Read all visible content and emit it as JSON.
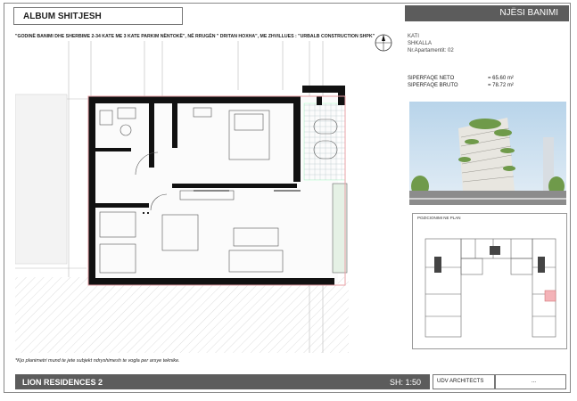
{
  "header": {
    "album": "ALBUM SHITJESH",
    "section": "NJËSI BANIMI"
  },
  "project_description": "\"GODINË BANIMI DHE SHERBIME 2-34 KATE ME 3 KATE PARKIM NËNTOKË\", NË RRUGËN \" DRITAN HOXHA\", ME ZHVILLUES : \"URBALB CONSTRUCTION SHPK\"",
  "unit": {
    "floor": "KATI",
    "stair": "SHKALLA",
    "apartment_no": "Nr.Apartamentit: 02"
  },
  "areas": [
    {
      "label": "SIPERFAQE NETO",
      "value": "= 65.60 m²"
    },
    {
      "label": "SIPERFAQE BRUTO",
      "value": "= 78.72 m²"
    }
  ],
  "position_plan_title": "POZICIONIMI NE PLAN",
  "note": "*Kjo planimetri mund te jete subjekt ndryshimesh te vogla per arsye teknike.",
  "footer": {
    "project": "LION  RESIDENCES 2",
    "scale": "SH:  1:50",
    "architects": "UDV ARCHITECTS",
    "extra": "..."
  },
  "colors": {
    "header_bar": "#5c5c5c",
    "wall": "#111111",
    "highlight": "#f4b3b8"
  }
}
